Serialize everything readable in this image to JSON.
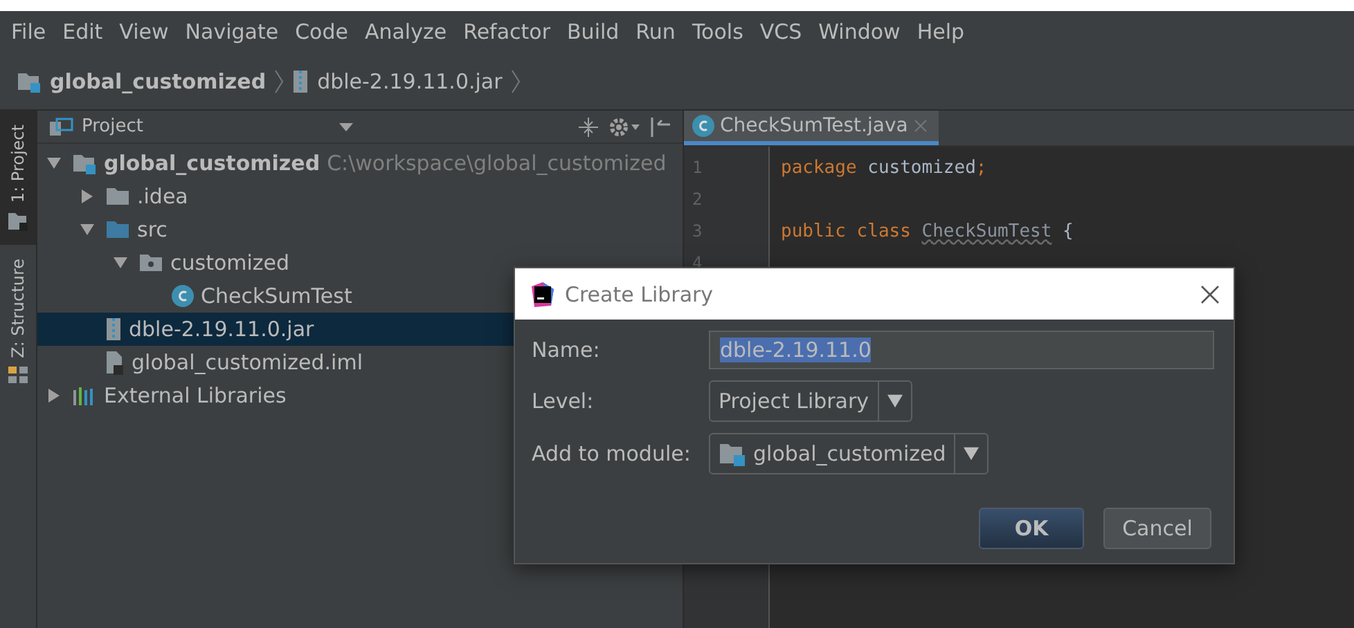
{
  "menu": [
    "File",
    "Edit",
    "View",
    "Navigate",
    "Code",
    "Analyze",
    "Refactor",
    "Build",
    "Run",
    "Tools",
    "VCS",
    "Window",
    "Help"
  ],
  "breadcrumbs": [
    {
      "label": "global_customized",
      "kind": "module"
    },
    {
      "label": "dble-2.19.11.0.jar",
      "kind": "jar"
    }
  ],
  "side_tabs": [
    {
      "label": "1: Project",
      "selected": true
    },
    {
      "label": "Z: Structure",
      "selected": false
    }
  ],
  "project_panel": {
    "title": "Project",
    "tree": [
      {
        "label": "global_customized",
        "kind": "module",
        "hint": "C:\\workspace\\global_customized",
        "expanded": true,
        "selected": false,
        "children": [
          {
            "label": ".idea",
            "kind": "folder",
            "expanded": false,
            "selected": false
          },
          {
            "label": "src",
            "kind": "source",
            "expanded": true,
            "selected": false,
            "children": [
              {
                "label": "customized",
                "kind": "package",
                "expanded": true,
                "selected": false,
                "children": [
                  {
                    "label": "CheckSumTest",
                    "kind": "class",
                    "selected": false
                  }
                ]
              }
            ]
          },
          {
            "label": "dble-2.19.11.0.jar",
            "kind": "jar",
            "selected": true
          },
          {
            "label": "global_customized.iml",
            "kind": "file",
            "selected": false
          }
        ]
      },
      {
        "label": "External Libraries",
        "kind": "libraries",
        "expanded": false,
        "selected": false
      }
    ]
  },
  "editor": {
    "tabs": [
      {
        "label": "CheckSumTest.java",
        "selected": true
      }
    ],
    "lines": [
      {
        "number": "1",
        "tokens": [
          {
            "text": "package",
            "kind": "keyword"
          },
          {
            "text": " customized",
            "kind": "plain"
          },
          {
            "text": ";",
            "kind": "keyword"
          }
        ]
      },
      {
        "number": "2"
      },
      {
        "number": "3",
        "tokens": [
          {
            "text": "public class ",
            "kind": "keyword"
          },
          {
            "text": "CheckSumTest",
            "kind": "unused"
          },
          {
            "text": " {",
            "kind": "plain"
          }
        ]
      },
      {
        "number": "4"
      }
    ]
  },
  "dialog": {
    "title": "Create Library",
    "name_label": "Name:",
    "name_value": "dble-2.19.11.0",
    "level_label": "Level:",
    "level_value": "Project Library",
    "module_label": "Add to module:",
    "module_value": "global_customized",
    "buttons": [
      {
        "label": "OK",
        "kind": "default"
      },
      {
        "label": "Cancel",
        "kind": "normal"
      }
    ]
  }
}
